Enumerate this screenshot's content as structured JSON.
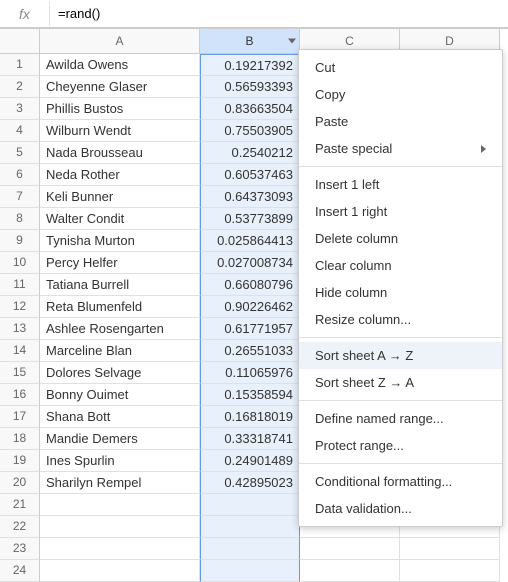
{
  "formula_bar": {
    "fx_label": "fx",
    "value": "=rand()"
  },
  "columns": [
    "A",
    "B",
    "C",
    "D"
  ],
  "selected_column": "B",
  "rows": [
    {
      "n": 1,
      "a": "Awilda Owens",
      "b": "0.19217392"
    },
    {
      "n": 2,
      "a": "Cheyenne Glaser",
      "b": "0.56593393"
    },
    {
      "n": 3,
      "a": "Phillis Bustos",
      "b": "0.83663504"
    },
    {
      "n": 4,
      "a": "Wilburn Wendt",
      "b": "0.75503905"
    },
    {
      "n": 5,
      "a": "Nada Brousseau",
      "b": "0.2540212"
    },
    {
      "n": 6,
      "a": "Neda Rother",
      "b": "0.60537463"
    },
    {
      "n": 7,
      "a": "Keli Bunner",
      "b": "0.64373093"
    },
    {
      "n": 8,
      "a": "Walter Condit",
      "b": "0.53773899"
    },
    {
      "n": 9,
      "a": "Tynisha Murton",
      "b": "0.025864413"
    },
    {
      "n": 10,
      "a": "Percy Helfer",
      "b": "0.027008734"
    },
    {
      "n": 11,
      "a": "Tatiana Burrell",
      "b": "0.66080796"
    },
    {
      "n": 12,
      "a": "Reta Blumenfeld",
      "b": "0.90226462"
    },
    {
      "n": 13,
      "a": "Ashlee Rosengarten",
      "b": "0.61771957"
    },
    {
      "n": 14,
      "a": "Marceline Blan",
      "b": "0.26551033"
    },
    {
      "n": 15,
      "a": "Dolores Selvage",
      "b": "0.11065976"
    },
    {
      "n": 16,
      "a": "Bonny Ouimet",
      "b": "0.15358594"
    },
    {
      "n": 17,
      "a": "Shana Bott",
      "b": "0.16818019"
    },
    {
      "n": 18,
      "a": "Mandie Demers",
      "b": "0.33318741"
    },
    {
      "n": 19,
      "a": "Ines Spurlin",
      "b": "0.24901489"
    },
    {
      "n": 20,
      "a": "Sharilyn Rempel",
      "b": "0.42895023"
    },
    {
      "n": 21,
      "a": "",
      "b": ""
    },
    {
      "n": 22,
      "a": "",
      "b": ""
    },
    {
      "n": 23,
      "a": "",
      "b": ""
    },
    {
      "n": 24,
      "a": "",
      "b": ""
    }
  ],
  "context_menu": {
    "items": [
      {
        "label": "Cut",
        "type": "item"
      },
      {
        "label": "Copy",
        "type": "item"
      },
      {
        "label": "Paste",
        "type": "item"
      },
      {
        "label": "Paste special",
        "type": "submenu"
      },
      {
        "type": "separator"
      },
      {
        "label": "Insert 1 left",
        "type": "item"
      },
      {
        "label": "Insert 1 right",
        "type": "item"
      },
      {
        "label": "Delete column",
        "type": "item"
      },
      {
        "label": "Clear column",
        "type": "item"
      },
      {
        "label": "Hide column",
        "type": "item"
      },
      {
        "label": "Resize column...",
        "type": "item"
      },
      {
        "type": "separator"
      },
      {
        "label": "Sort sheet A → Z",
        "type": "item",
        "hover": true
      },
      {
        "label": "Sort sheet Z → A",
        "type": "item"
      },
      {
        "type": "separator"
      },
      {
        "label": "Define named range...",
        "type": "item"
      },
      {
        "label": "Protect range...",
        "type": "item"
      },
      {
        "type": "separator"
      },
      {
        "label": "Conditional formatting...",
        "type": "item"
      },
      {
        "label": "Data validation...",
        "type": "item"
      }
    ]
  }
}
